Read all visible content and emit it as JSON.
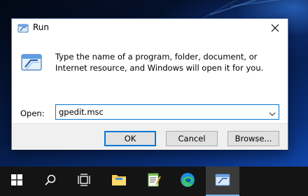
{
  "dialog": {
    "title": "Run",
    "description": "Type the name of a program, folder, document, or Internet resource, and Windows will open it for you.",
    "open_label": "Open:",
    "open_value": "gpedit.msc",
    "buttons": {
      "ok": "OK",
      "cancel": "Cancel",
      "browse": "Browse..."
    },
    "icons": {
      "title": "run-icon",
      "main": "run-program-icon",
      "close": "close-icon",
      "dropdown": "chevron-down-icon"
    }
  },
  "taskbar": {
    "items": [
      {
        "name": "start",
        "icon": "windows-logo-icon"
      },
      {
        "name": "search",
        "icon": "search-icon"
      },
      {
        "name": "task-view",
        "icon": "task-view-icon"
      },
      {
        "name": "file-explorer",
        "icon": "folder-icon"
      },
      {
        "name": "notepad",
        "icon": "notepad-icon"
      },
      {
        "name": "edge",
        "icon": "edge-icon"
      },
      {
        "name": "run",
        "icon": "run-icon",
        "active": true
      }
    ]
  },
  "colors": {
    "accent": "#0078d7",
    "taskbar": "#141414",
    "button_bar": "#f0f0f0"
  }
}
